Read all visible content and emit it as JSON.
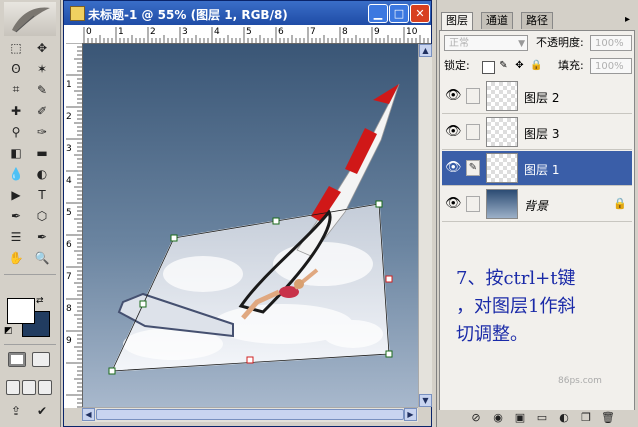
{
  "window": {
    "title": "未标题-1 @ 55% (图层 1, RGB/8)",
    "minimize": "▁",
    "maximize": "□",
    "close": "✕"
  },
  "rulers": {
    "top": [
      "0",
      "1",
      "2",
      "3",
      "4",
      "5",
      "6",
      "7",
      "8",
      "9",
      "10"
    ],
    "left": [
      "1",
      "2",
      "3",
      "4",
      "5",
      "6",
      "7",
      "8",
      "9"
    ]
  },
  "toolbox": {
    "tools": [
      "marquee-icon",
      "move-icon",
      "lasso-icon",
      "magic-wand-icon",
      "crop-icon",
      "slice-icon",
      "healing-icon",
      "brush-icon",
      "stamp-icon",
      "history-brush-icon",
      "eraser-icon",
      "gradient-icon",
      "blur-icon",
      "dodge-icon",
      "path-select-icon",
      "type-icon",
      "pen-icon",
      "shape-icon",
      "notes-icon",
      "eyedropper-icon",
      "hand-icon",
      "zoom-icon"
    ],
    "glyphs": [
      "⬚",
      "✥",
      "ʘ",
      "✶",
      "⌗",
      "✎",
      "✚",
      "✐",
      "⚲",
      "✑",
      "◧",
      "▬",
      "💧",
      "◐",
      "▶",
      "T",
      "✒",
      "⬡",
      "☰",
      "✒",
      "✋",
      "🔍"
    ],
    "foreground_color": "#ffffff",
    "background_color": "#213c60"
  },
  "layers_panel": {
    "tabs": [
      "图层",
      "通道",
      "路径"
    ],
    "blend_mode": "正常",
    "opacity_label": "不透明度:",
    "opacity_value": "100%",
    "lock_label": "锁定:",
    "fill_label": "填充:",
    "fill_value": "100%",
    "layers": [
      {
        "name": "图层 2",
        "selected": false,
        "thumb": "checker"
      },
      {
        "name": "图层 3",
        "selected": false,
        "thumb": "checker"
      },
      {
        "name": "图层 1",
        "selected": true,
        "thumb": "checker"
      },
      {
        "name": "背景",
        "selected": false,
        "thumb": "gradient",
        "locked": true
      }
    ],
    "annotation_lines": [
      "7、按ctrl+t键",
      "，对图层1作斜",
      "切调整。"
    ],
    "watermark": "86ps.com"
  }
}
